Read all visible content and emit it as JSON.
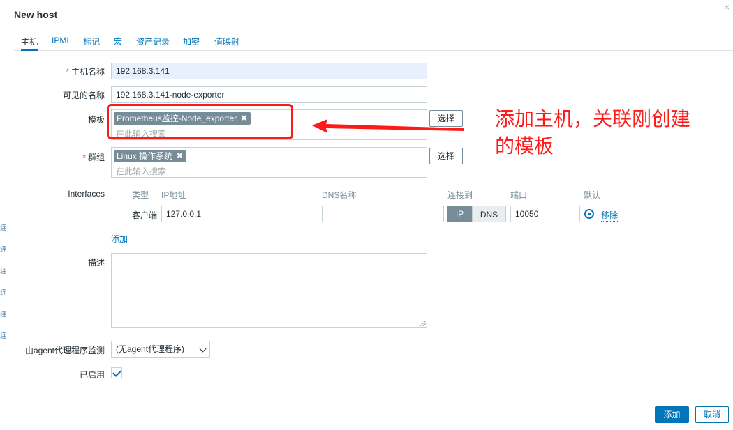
{
  "dialog": {
    "title": "New host",
    "close_icon": "×"
  },
  "tabs": [
    "主机",
    "IPMI",
    "标记",
    "宏",
    "资产记录",
    "加密",
    "值映射"
  ],
  "form": {
    "host_name": {
      "label": "主机名称",
      "required": "*",
      "value": "192.168.3.141"
    },
    "visible_name": {
      "label": "可见的名称",
      "value": "192.168.3.141-node-exporter"
    },
    "templates": {
      "label": "模板",
      "chip": "Prometheus监控-Node_exporter",
      "placeholder": "在此输入搜索",
      "select_button": "选择"
    },
    "groups": {
      "label": "群组",
      "required": "*",
      "chip": "Linux 操作系统",
      "placeholder": "在此输入搜索",
      "select_button": "选择"
    },
    "interfaces": {
      "label": "Interfaces",
      "headers": {
        "type": "类型",
        "ip": "IP地址",
        "dns": "DNS名称",
        "connect": "连接到",
        "port": "端口",
        "default": "默认"
      },
      "row": {
        "type": "客户端",
        "ip": "127.0.0.1",
        "dns": "",
        "ip_btn": "IP",
        "dns_btn": "DNS",
        "port": "10050",
        "remove": "移除"
      },
      "add_link": "添加"
    },
    "description": {
      "label": "描述",
      "value": ""
    },
    "proxy": {
      "label": "由agent代理程序监测",
      "value": "(无agent代理程序)"
    },
    "enabled": {
      "label": "已启用",
      "checked": true
    }
  },
  "footer": {
    "add": "添加",
    "cancel": "取消"
  },
  "annotation": {
    "line1": "添加主机，关联刚创建",
    "line2": "的模板"
  },
  "left_strip_marks": [
    "连",
    "连",
    "连",
    "连",
    "连",
    "连"
  ],
  "colors": {
    "accent": "#0275b8",
    "annotation_red": "#ff1a1a",
    "chip_bg": "#768d99"
  }
}
